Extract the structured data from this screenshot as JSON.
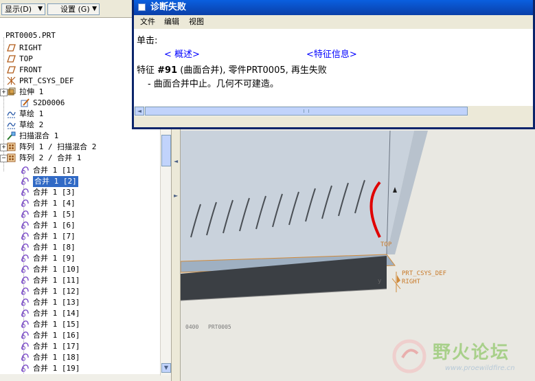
{
  "toolbar": {
    "show_label": "显示",
    "show_key": "(D)",
    "settings_label": "设置",
    "settings_key": "(G)"
  },
  "tree": {
    "root": "PRT0005.PRT",
    "datums": [
      "RIGHT",
      "TOP",
      "FRONT"
    ],
    "csys": "PRT_CSYS_DEF",
    "extrude": "拉伸 1",
    "extrude_child": "S2D0006",
    "sketch1": "草绘 1",
    "sketch2": "草绘 2",
    "swept_blend": "扫描混合 1",
    "pattern1": "阵列 1 / 扫描混合 2",
    "pattern2": "阵列 2 / 合并 1",
    "merges": [
      "合并 1 [1]",
      "合并 1 [2]",
      "合并 1 [3]",
      "合并 1 [4]",
      "合并 1 [5]",
      "合并 1 [6]",
      "合并 1 [7]",
      "合并 1 [8]",
      "合并 1 [9]",
      "合并 1 [10]",
      "合并 1 [11]",
      "合并 1 [12]",
      "合并 1 [13]",
      "合并 1 [14]",
      "合并 1 [15]",
      "合并 1 [16]",
      "合并 1 [17]",
      "合并 1 [18]",
      "合并 1 [19]"
    ],
    "selected_index": 1
  },
  "dialog": {
    "title": "诊断失败",
    "menu": [
      "文件",
      "编辑",
      "视图"
    ],
    "click_label": "单击:",
    "link_overview": "< 概述>",
    "link_feature_info": "<特征信息>",
    "message_prefix": "特征 ",
    "message_bold": "#91",
    "message_rest": " (曲面合并), 零件PRT0005,  再生失败",
    "message_detail": "- 曲面合并中止。几何不可建造。"
  },
  "graphics": {
    "label_top": "TOP",
    "label_csys": "PRT_CSYS_DEF",
    "label_right": "RIGHT",
    "model_name": "PRT0005",
    "model_prefix": "0400"
  },
  "watermark": {
    "text": "野火论坛",
    "url": "www.proewildfire.cn"
  },
  "colors": {
    "titlebar": "#0a46c8",
    "selection": "#316ac5",
    "error_curve": "#e00000",
    "datum_label": "#c87a2a",
    "viewport_bg": "#c9d2dc"
  }
}
